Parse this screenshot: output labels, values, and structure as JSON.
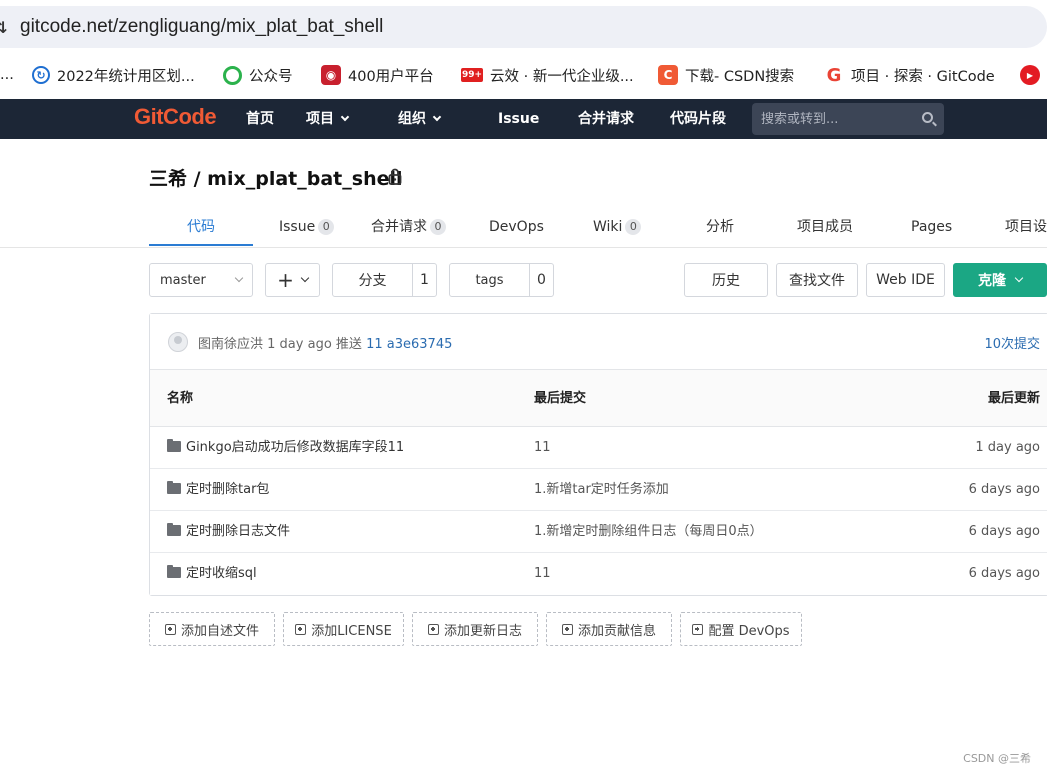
{
  "browser": {
    "url": "gitcode.net/zengliguang/mix_plat_bat_shell",
    "bookmarks": [
      {
        "label": "...",
        "icon": ""
      },
      {
        "label": "2022年统计用区划...",
        "icon": "refresh-logo-icon",
        "color": "#1f6fd1"
      },
      {
        "label": "公众号",
        "icon": "wechat-logo-icon",
        "color": "#2bb24c"
      },
      {
        "label": "400用户平台",
        "icon": "pdf-logo-icon",
        "color": "#c8202e"
      },
      {
        "label": "云效 · 新一代企业级...",
        "icon": "badge-99-icon",
        "color": "#e02020"
      },
      {
        "label": "下载- CSDN搜索",
        "icon": "csdn-logo-icon",
        "color": "#f05a35"
      },
      {
        "label": "项目 · 探索 · GitCode",
        "icon": "google-logo-icon",
        "color": "#ea4335"
      },
      {
        "label": "",
        "icon": "youtube-logo-icon",
        "color": "#e31b23"
      }
    ]
  },
  "nav": {
    "logo": "GitCode",
    "items": [
      "首页",
      "项目",
      "组织",
      "Issue",
      "合并请求",
      "代码片段"
    ],
    "search_placeholder": "搜索或转到..."
  },
  "repo": {
    "title": "三希 / mix_plat_bat_shell",
    "tabs": [
      {
        "label": "代码",
        "count": null
      },
      {
        "label": "Issue",
        "count": "0"
      },
      {
        "label": "合并请求",
        "count": "0"
      },
      {
        "label": "DevOps",
        "count": null
      },
      {
        "label": "Wiki",
        "count": "0"
      },
      {
        "label": "分析",
        "count": null
      },
      {
        "label": "项目成员",
        "count": null
      },
      {
        "label": "Pages",
        "count": null
      },
      {
        "label": "项目设",
        "count": null
      }
    ],
    "toolbar": {
      "branch": "master",
      "branches_label": "分支",
      "branches_count": "1",
      "tags_label": "tags",
      "tags_count": "0",
      "history": "历史",
      "find_file": "查找文件",
      "web_ide": "Web IDE",
      "clone": "克隆"
    },
    "last_commit": {
      "author": "图南徐应洪",
      "time": "1 day ago",
      "action": "推送",
      "message": "11",
      "sha": "a3e63745",
      "commit_count": "10次提交"
    },
    "table": {
      "headers": [
        "名称",
        "最后提交",
        "最后更新"
      ],
      "rows": [
        {
          "name": "Ginkgo启动成功后修改数据库字段11",
          "commit": "11",
          "updated": "1 day ago"
        },
        {
          "name": "定时删除tar包",
          "commit": "1.新增tar定时任务添加",
          "updated": "6 days ago"
        },
        {
          "name": "定时删除日志文件",
          "commit": "1.新增定时删除组件日志（每周日0点）",
          "updated": "6 days ago"
        },
        {
          "name": "定时收缩sql",
          "commit": "11",
          "updated": "6 days ago"
        }
      ]
    },
    "add_buttons": [
      "添加自述文件",
      "添加LICENSE",
      "添加更新日志",
      "添加贡献信息",
      "配置 DevOps"
    ]
  },
  "watermark": "CSDN @三希",
  "colors": {
    "nav_bg": "#1c2636",
    "accent_blue": "#2b7cd3",
    "clone_green": "#1ba784",
    "logo_orange": "#f05a35"
  }
}
